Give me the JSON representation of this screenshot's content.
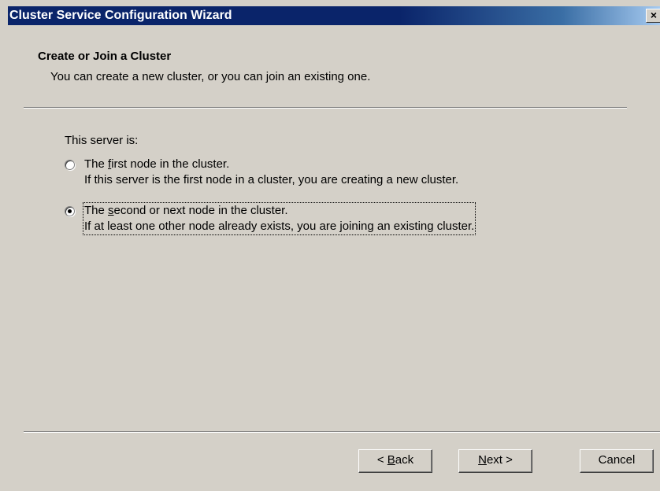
{
  "window": {
    "title": "Cluster Service Configuration Wizard",
    "close_label": "×"
  },
  "header": {
    "title": "Create or Join a Cluster",
    "subtitle": "You can create a new cluster, or you can join an existing one."
  },
  "main": {
    "section_label": "This server is:",
    "options": [
      {
        "prefix": "The ",
        "accel": "f",
        "suffix": "irst node in the cluster.",
        "description": "If this server is the first node in a cluster, you are creating a new cluster.",
        "selected": false
      },
      {
        "prefix": "The ",
        "accel": "s",
        "suffix": "econd or next node in the cluster.",
        "description": "If at least one other node already exists, you are joining an existing cluster.",
        "selected": true
      }
    ]
  },
  "footer": {
    "back_prefix": "< ",
    "back_accel": "B",
    "back_suffix": "ack",
    "next_accel": "N",
    "next_suffix": "ext >",
    "cancel_label": "Cancel"
  }
}
